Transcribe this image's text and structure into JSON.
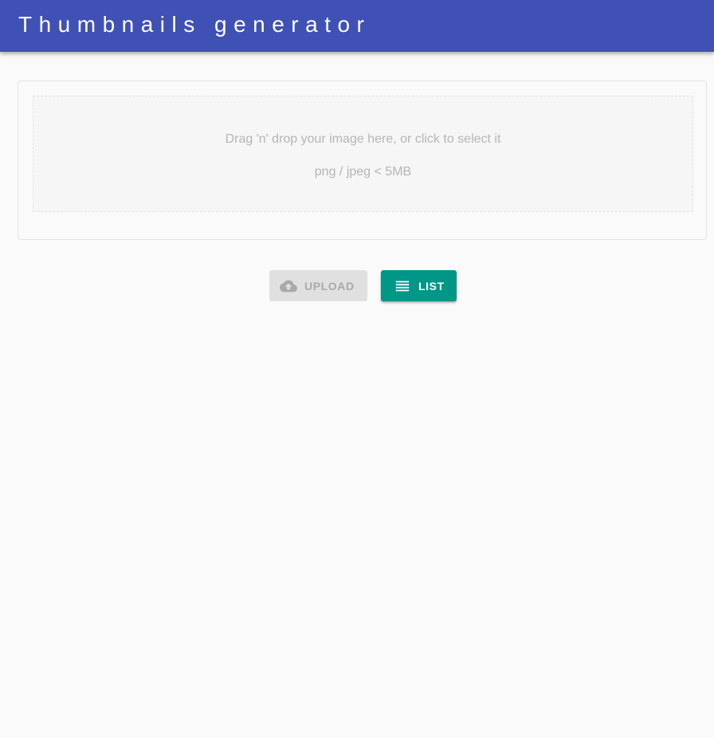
{
  "header": {
    "title": "Thumbnails generator",
    "color": "#3f51b5"
  },
  "dropzone": {
    "instruction": "Drag 'n' drop your image here, or click to select it",
    "constraints": "png / jpeg < 5MB"
  },
  "actions": {
    "upload": {
      "label": "UPLOAD",
      "icon": "cloud-upload-icon",
      "disabled": true
    },
    "list": {
      "label": "LIST",
      "icon": "list-icon",
      "color": "#009688"
    }
  }
}
